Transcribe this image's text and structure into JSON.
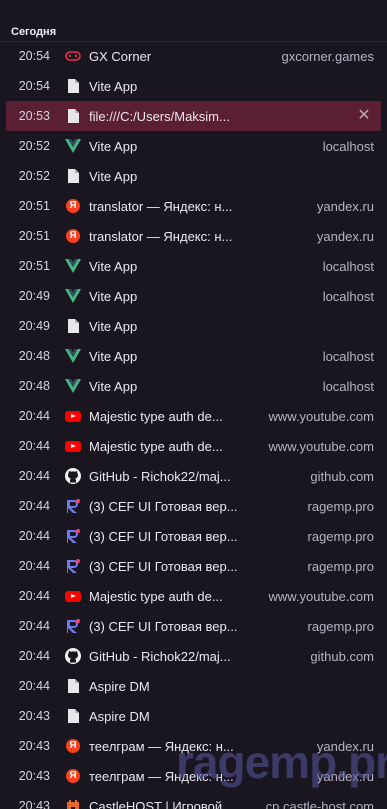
{
  "section": {
    "header": "Сегодня"
  },
  "rows": [
    {
      "time": "20:54",
      "icon": "gx-corner-icon",
      "title": "GX Corner",
      "domain": "gxcorner.games"
    },
    {
      "time": "20:54",
      "icon": "file-icon",
      "title": "Vite App",
      "domain": ""
    },
    {
      "time": "20:53",
      "icon": "file-icon",
      "title": "file:///C:/Users/Maksim...",
      "domain": "",
      "selected": true
    },
    {
      "time": "20:52",
      "icon": "vue-icon",
      "title": "Vite App",
      "domain": "localhost"
    },
    {
      "time": "20:52",
      "icon": "file-icon",
      "title": "Vite App",
      "domain": ""
    },
    {
      "time": "20:51",
      "icon": "yandex-icon",
      "title": "translator — Яндекс: н...",
      "domain": "yandex.ru"
    },
    {
      "time": "20:51",
      "icon": "yandex-icon",
      "title": "translator — Яндекс: н...",
      "domain": "yandex.ru"
    },
    {
      "time": "20:51",
      "icon": "vue-icon",
      "title": "Vite App",
      "domain": "localhost"
    },
    {
      "time": "20:49",
      "icon": "vue-icon",
      "title": "Vite App",
      "domain": "localhost"
    },
    {
      "time": "20:49",
      "icon": "file-icon",
      "title": "Vite App",
      "domain": ""
    },
    {
      "time": "20:48",
      "icon": "vue-icon",
      "title": "Vite App",
      "domain": "localhost"
    },
    {
      "time": "20:48",
      "icon": "vue-icon",
      "title": "Vite App",
      "domain": "localhost"
    },
    {
      "time": "20:44",
      "icon": "youtube-icon",
      "title": "Majestic type auth de...",
      "domain": "www.youtube.com"
    },
    {
      "time": "20:44",
      "icon": "youtube-icon",
      "title": "Majestic type auth de...",
      "domain": "www.youtube.com"
    },
    {
      "time": "20:44",
      "icon": "github-icon",
      "title": "GitHub - Richok22/maj...",
      "domain": "github.com"
    },
    {
      "time": "20:44",
      "icon": "ragemp-icon",
      "title": "(3) CEF UI Готовая вер...",
      "domain": "ragemp.pro"
    },
    {
      "time": "20:44",
      "icon": "ragemp-icon",
      "title": "(3) CEF UI Готовая вер...",
      "domain": "ragemp.pro"
    },
    {
      "time": "20:44",
      "icon": "ragemp-icon",
      "title": "(3) CEF UI Готовая вер...",
      "domain": "ragemp.pro"
    },
    {
      "time": "20:44",
      "icon": "youtube-icon",
      "title": "Majestic type auth de...",
      "domain": "www.youtube.com"
    },
    {
      "time": "20:44",
      "icon": "ragemp-icon",
      "title": "(3) CEF UI Готовая вер...",
      "domain": "ragemp.pro"
    },
    {
      "time": "20:44",
      "icon": "github-icon",
      "title": "GitHub - Richok22/maj...",
      "domain": "github.com"
    },
    {
      "time": "20:44",
      "icon": "file-icon",
      "title": "Aspire DM",
      "domain": ""
    },
    {
      "time": "20:43",
      "icon": "file-icon",
      "title": "Aspire DM",
      "domain": ""
    },
    {
      "time": "20:43",
      "icon": "yandex-icon",
      "title": "теелграм — Яндекс: н...",
      "domain": "yandex.ru"
    },
    {
      "time": "20:43",
      "icon": "yandex-icon",
      "title": "теелграм — Яндекс: н...",
      "domain": "yandex.ru"
    },
    {
      "time": "20:43",
      "icon": "castlehost-icon",
      "title": "CastleHOST | Игровой...",
      "domain": "cp.castle-host.com"
    }
  ],
  "close_glyph": "✕",
  "watermark": "ragemp.pro",
  "colors": {
    "selected_row": "#5a1f33",
    "background": "#1a1620",
    "vue_green": "#42b883",
    "yandex_red": "#fc3f1d",
    "youtube_red": "#ff0000",
    "gx_red": "#e8304a"
  }
}
